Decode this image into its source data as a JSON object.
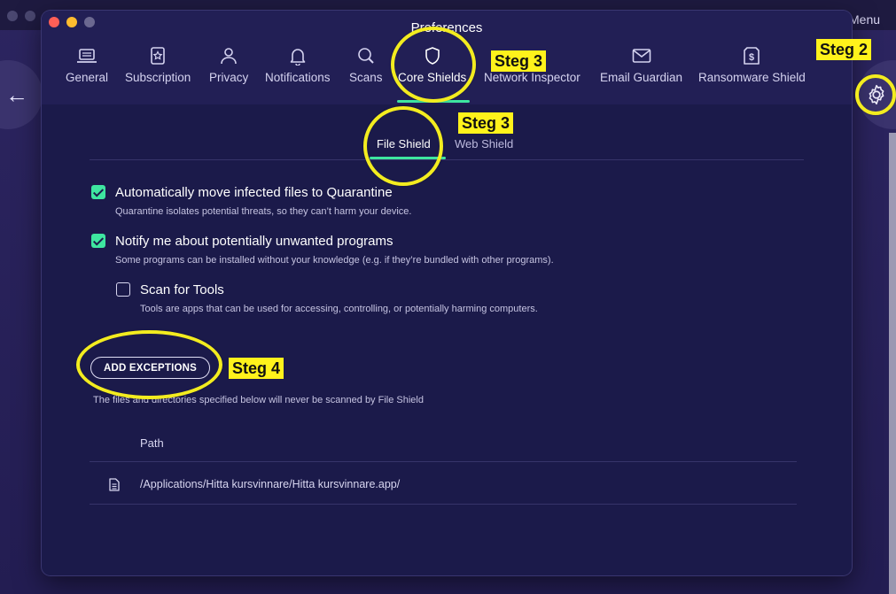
{
  "background": {
    "menu_label": "Menu"
  },
  "window": {
    "title": "Preferences"
  },
  "tabs": [
    {
      "label": "General",
      "icon": "laptop-icon"
    },
    {
      "label": "Subscription",
      "icon": "star-badge-icon"
    },
    {
      "label": "Privacy",
      "icon": "person-icon"
    },
    {
      "label": "Notifications",
      "icon": "bell-icon"
    },
    {
      "label": "Scans",
      "icon": "search-icon"
    },
    {
      "label": "Core Shields",
      "icon": "shield-icon",
      "active": true
    },
    {
      "label": "Network Inspector",
      "icon": ""
    },
    {
      "label": "Email Guardian",
      "icon": "mail-icon"
    },
    {
      "label": "Ransomware Shield",
      "icon": "dollar-shield-icon"
    }
  ],
  "subtabs": [
    {
      "label": "File Shield",
      "active": true
    },
    {
      "label": "Web Shield",
      "active": false
    }
  ],
  "options": [
    {
      "title": "Automatically move infected files to Quarantine",
      "description": "Quarantine isolates potential threats, so they can’t harm your device.",
      "checked": true
    },
    {
      "title": "Notify me about potentially unwanted programs",
      "description": "Some programs can be installed without your knowledge (e.g. if they’re bundled with other programs).",
      "checked": true
    },
    {
      "title": "Scan for Tools",
      "description": "Tools are apps that can be used for accessing, controlling, or potentially harming computers.",
      "checked": false
    }
  ],
  "exceptions": {
    "button_label": "ADD EXCEPTIONS",
    "note": "The files and directories specified below will never be scanned by File Shield",
    "column_header": "Path",
    "rows": [
      {
        "path": "/Applications/Hitta kursvinnare/Hitta kursvinnare.app/"
      }
    ]
  },
  "annotations": {
    "steg2": "Steg 2",
    "steg3_tab": "Steg 3",
    "steg3_subtab": "Steg 3",
    "steg4": "Steg 4",
    "highlight_color": "#fff21b"
  },
  "colors": {
    "accent": "#3ee6a0",
    "window_bg": "#1b1a4a",
    "header_bg": "#221f55"
  }
}
